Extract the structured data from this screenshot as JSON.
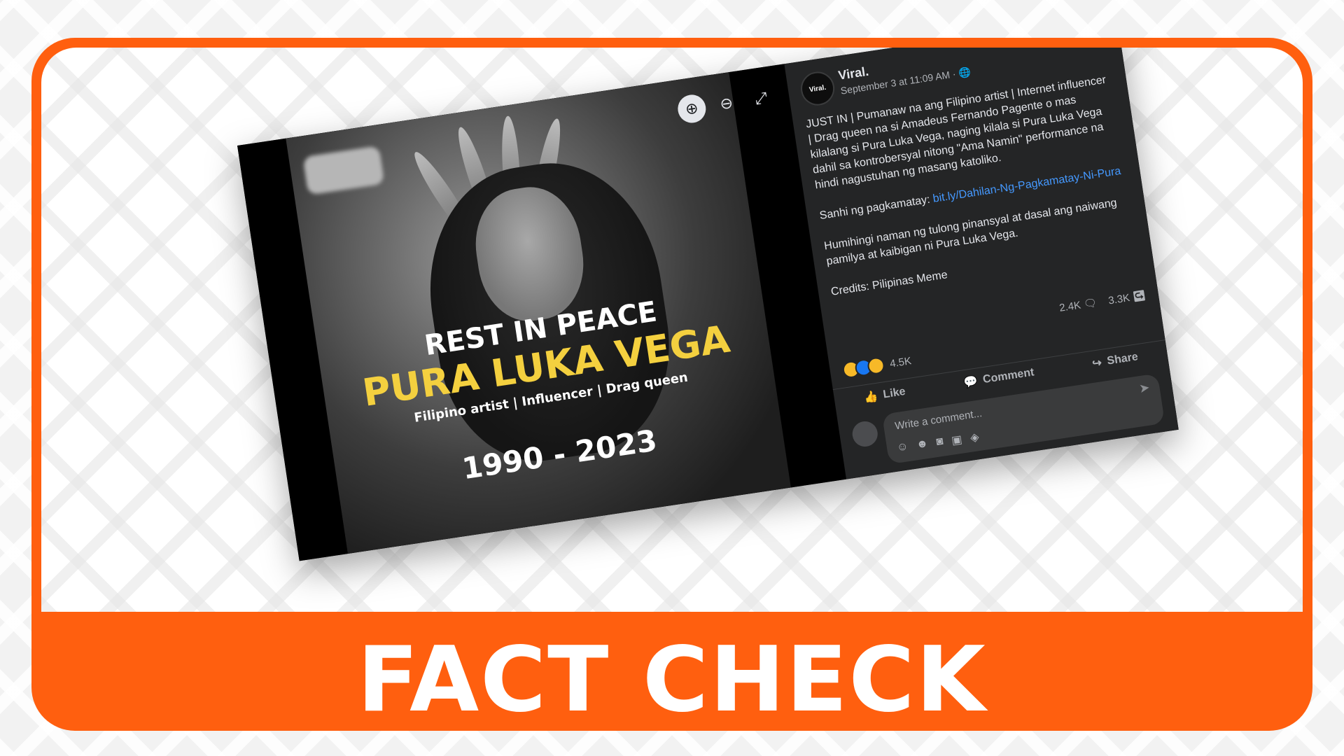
{
  "banner": {
    "title": "FACT CHECK"
  },
  "image": {
    "rip_line1": "REST IN PEACE",
    "rip_line2": "PURA LUKA VEGA",
    "rip_line3": "Filipino artist | Influencer | Drag queen",
    "rip_line4": "1990 - 2023",
    "viewer_buttons": [
      "zoom-in-icon",
      "zoom-out-icon",
      "fullscreen-icon"
    ]
  },
  "post": {
    "avatar_text": "Viral.",
    "page_name": "Viral.",
    "timestamp": "September 3 at 11:09 AM ·",
    "paragraph1": "JUST IN | Pumanaw na ang Filipino artist | Internet influencer | Drag queen na si Amadeus Fernando Pagente o mas kilalang si Pura Luka Vega, naging kilala si Pura Luka Vega dahil sa kontrobersyal nitong \"Ama Namin\" performance na hindi nagustuhan ng masang katoliko.",
    "cause_label": "Sanhi ng pagkamatay: ",
    "cause_link": "bit.ly/Dahilan-Ng-Pagkamatay-Ni-Pura",
    "paragraph3": "Humihingi naman ng tulong pinansyal at dasal ang naiwang pamilya at kaibigan ni Pura Luka Vega.",
    "credits": "Credits: Pilipinas Meme",
    "comments_count": "2.4K",
    "shares_count": "3.3K",
    "reactions_count": "4.5K",
    "like_label": "Like",
    "comment_label": "Comment",
    "share_label": "Share",
    "comment_placeholder": "Write a comment..."
  },
  "colors": {
    "brand_orange": "#ff5f0f",
    "fb_dark": "#242526",
    "link_blue": "#4599ff",
    "rip_yellow": "#f4d03f"
  }
}
